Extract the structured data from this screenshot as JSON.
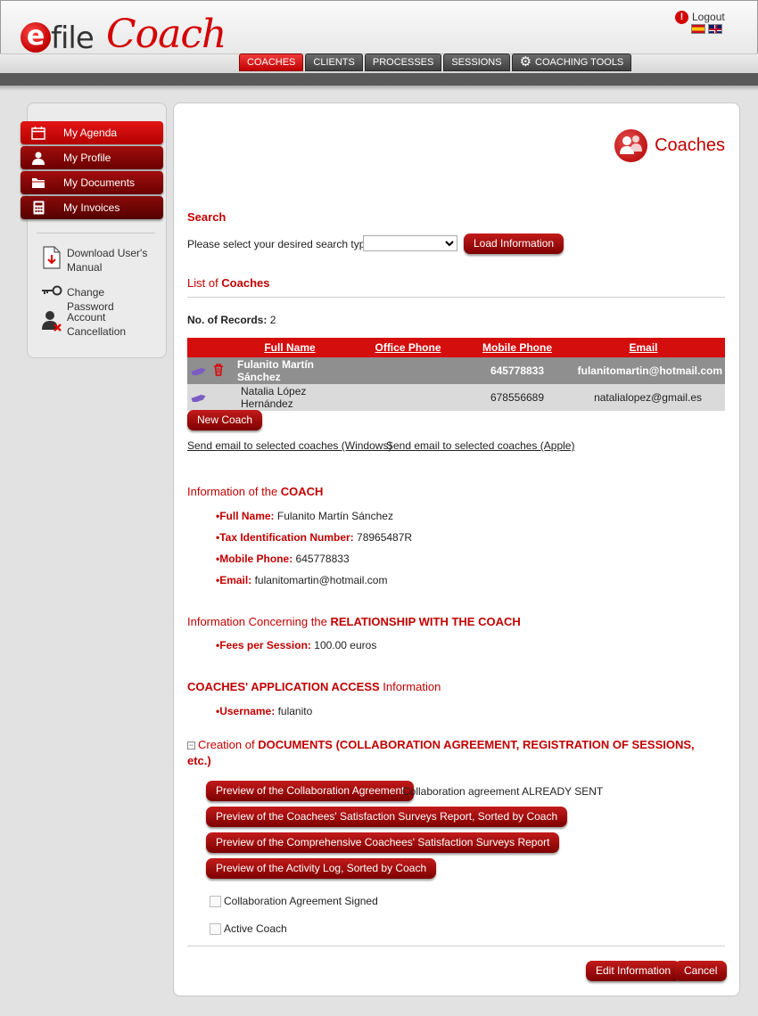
{
  "header": {
    "logout_label": "Logout",
    "logo_e": "e",
    "logo_file": "file",
    "logo_coach": "Coach",
    "flags": [
      "es-flag",
      "uk-flag"
    ]
  },
  "nav": {
    "tabs": [
      {
        "label": "COACHES",
        "active": true
      },
      {
        "label": "CLIENTS",
        "active": false
      },
      {
        "label": "PROCESSES",
        "active": false
      },
      {
        "label": "SESSIONS",
        "active": false
      },
      {
        "label": "COACHING TOOLS",
        "active": false,
        "icon": "gear-icon"
      }
    ]
  },
  "sidebar": {
    "buttons": [
      {
        "label": "My Agenda",
        "icon": "calendar-icon"
      },
      {
        "label": "My Profile",
        "icon": "person-icon"
      },
      {
        "label": "My Documents",
        "icon": "folder-icon"
      },
      {
        "label": "My Invoices",
        "icon": "calculator-icon"
      }
    ],
    "links": [
      {
        "label": "Download User's Manual",
        "icon": "pdf-download-icon"
      },
      {
        "label": "Change Password",
        "icon": "key-icon"
      },
      {
        "label": "Account Cancellation",
        "icon": "user-remove-icon"
      }
    ]
  },
  "page": {
    "title": "Coaches",
    "search": {
      "title": "Search",
      "label": "Please select your desired search type:",
      "selected_value": "",
      "load_button": "Load Information"
    },
    "list": {
      "title_prefix": "List of ",
      "title_bold": "Coaches",
      "records_label": "No. of Records:",
      "records_count": "2",
      "columns": [
        "",
        "Full Name",
        "Office Phone",
        "Mobile Phone",
        "Email"
      ],
      "rows": [
        {
          "full_name": "Fulanito Martín Sánchez",
          "office_phone": "",
          "mobile_phone": "645778833",
          "email": "fulanitomartin@hotmail.com",
          "selected": true
        },
        {
          "full_name": "Natalia López Hernández",
          "office_phone": "",
          "mobile_phone": "678556689",
          "email": "natalialopez@gmail.es",
          "selected": false
        }
      ],
      "new_coach_button": "New Coach",
      "email_windows": "Send email to selected coaches (Windows)",
      "email_apple": "Send email to selected coaches (Apple)"
    },
    "coach_info": {
      "title_prefix": "Information of the ",
      "title_bold": "COACH",
      "fields": [
        {
          "label": "Full Name:",
          "value": "Fulanito Martín Sánchez"
        },
        {
          "label": "Tax Identification Number:",
          "value": "78965487R"
        },
        {
          "label": "Mobile Phone:",
          "value": "645778833"
        },
        {
          "label": "Email:",
          "value": "fulanitomartin@hotmail.com"
        }
      ]
    },
    "relationship": {
      "title_prefix": "Information Concerning the ",
      "title_bold": "RELATIONSHIP WITH THE COACH",
      "fields": [
        {
          "label": "Fees per Session:",
          "value": "100.00 euros"
        }
      ]
    },
    "access": {
      "title_bold": "COACHES' APPLICATION ACCESS",
      "title_suffix": " Information",
      "fields": [
        {
          "label": "Username:",
          "value": "fulanito"
        }
      ]
    },
    "documents": {
      "collapse_symbol": "−",
      "title_prefix": "Creation of ",
      "title_bold": "DOCUMENTS (COLLABORATION AGREEMENT, REGISTRATION OF SESSIONS, etc.)",
      "buttons": [
        {
          "label": "Preview of the Collaboration Agreement",
          "note": "Collaboration agreement ALREADY SENT"
        },
        {
          "label": "Preview of the Coachees' Satisfaction Surveys Report, Sorted by Coach",
          "note": ""
        },
        {
          "label": "Preview of the Comprehensive Coachees' Satisfaction Surveys Report",
          "note": ""
        },
        {
          "label": "Preview of the Activity Log, Sorted by Coach",
          "note": ""
        }
      ],
      "checkboxes": [
        {
          "label": "Collaboration Agreement Signed",
          "checked": false
        },
        {
          "label": "Active Coach",
          "checked": false
        }
      ]
    },
    "footer": {
      "edit_button": "Edit Information",
      "cancel_button": "Cancel"
    }
  }
}
